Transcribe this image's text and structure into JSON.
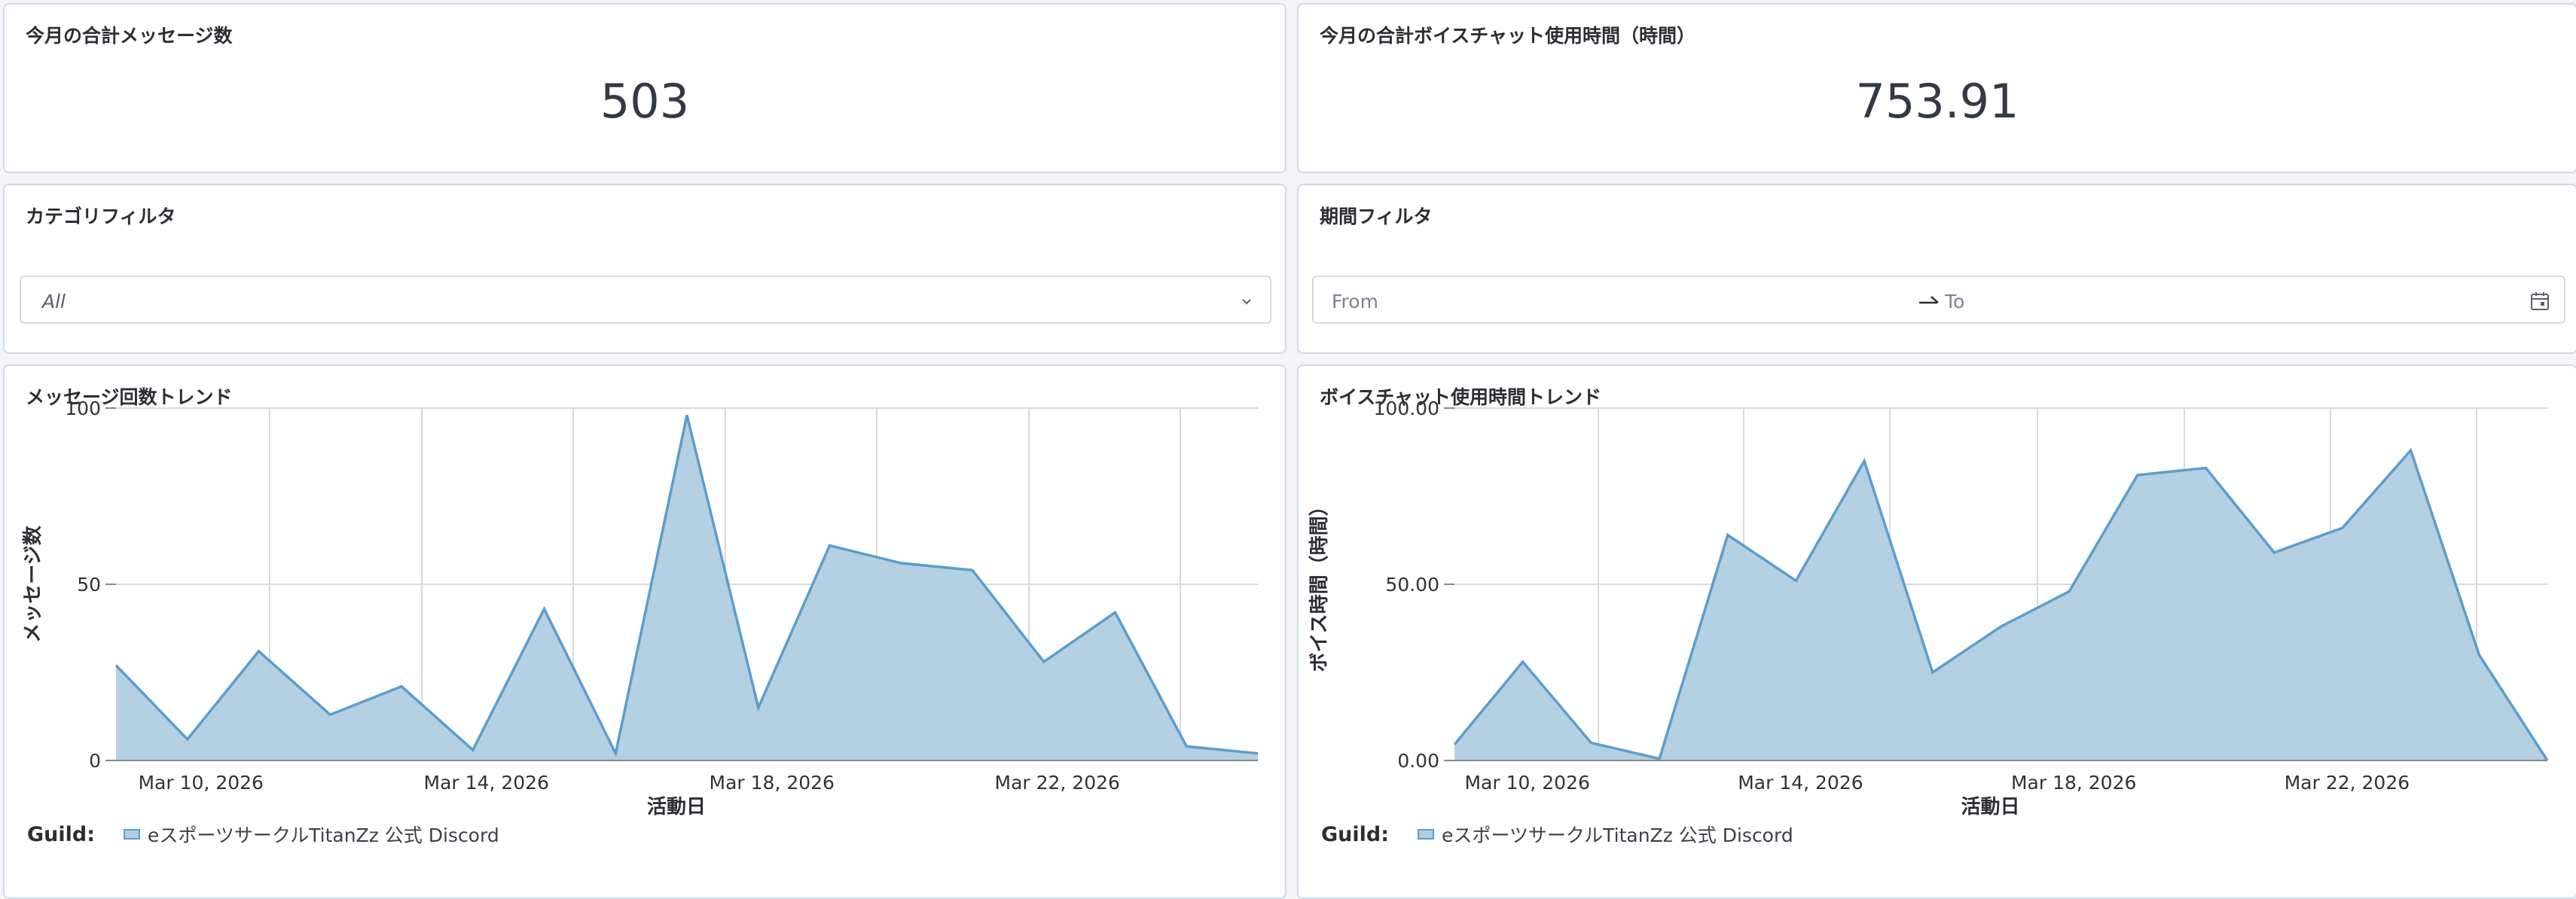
{
  "kpi_messages": {
    "title": "今月の合計メッセージ数",
    "value": "503"
  },
  "kpi_voice": {
    "title": "今月の合計ボイスチャット使用時間（時間）",
    "value": "753.91"
  },
  "category_filter": {
    "title": "カテゴリフィルタ",
    "selected": "All"
  },
  "period_filter": {
    "title": "期間フィルタ",
    "from_placeholder": "From",
    "to_placeholder": "To"
  },
  "message_trend": {
    "title": "メッセージ回数トレンド",
    "legend_label": "Guild:",
    "legend_item": "eスポーツサークルTitanZz 公式 Discord"
  },
  "voice_trend": {
    "title": "ボイスチャット使用時間トレンド",
    "legend_label": "Guild:",
    "legend_item": "eスポーツサークルTitanZz 公式 Discord"
  },
  "colors": {
    "area_fill": "#b0cde2",
    "area_line": "#5d9dcc",
    "card_border": "#cfdbe4",
    "background": "#f3f5f8"
  },
  "chart_data": [
    {
      "type": "area",
      "ylabel": "メッセージ数",
      "xlabel": "活動日",
      "x": [
        "2026-03-09",
        "2026-03-10",
        "2026-03-11",
        "2026-03-12",
        "2026-03-13",
        "2026-03-14",
        "2026-03-15",
        "2026-03-16",
        "2026-03-17",
        "2026-03-18",
        "2026-03-19",
        "2026-03-20",
        "2026-03-21",
        "2026-03-22",
        "2026-03-23",
        "2026-03-24",
        "2026-03-25"
      ],
      "series": [
        {
          "name": "eスポーツサークルTitanZz 公式 Discord",
          "values": [
            27,
            6,
            31,
            13,
            21,
            3,
            43,
            2,
            98,
            15,
            61,
            56,
            54,
            28,
            42,
            4,
            2
          ]
        }
      ],
      "ylim": [
        0,
        100
      ],
      "yticks": [
        "0",
        "50",
        "100"
      ],
      "xticks": [
        "Mar 10, 2026",
        "Mar 14, 2026",
        "Mar 18, 2026",
        "Mar 22, 2026"
      ],
      "grid": true,
      "legend": "bottom-left"
    },
    {
      "type": "area",
      "ylabel": "ボイス時間（時間）",
      "xlabel": "活動日",
      "x": [
        "2026-03-09",
        "2026-03-10",
        "2026-03-11",
        "2026-03-12",
        "2026-03-13",
        "2026-03-14",
        "2026-03-15",
        "2026-03-16",
        "2026-03-17",
        "2026-03-18",
        "2026-03-19",
        "2026-03-20",
        "2026-03-21",
        "2026-03-22",
        "2026-03-23",
        "2026-03-24",
        "2026-03-25"
      ],
      "series": [
        {
          "name": "eスポーツサークルTitanZz 公式 Discord",
          "values": [
            4.5,
            28,
            5,
            0.5,
            64,
            51,
            85,
            25,
            38,
            48,
            81,
            83,
            59,
            66,
            88,
            30,
            0
          ]
        }
      ],
      "ylim": [
        0,
        100
      ],
      "yticks": [
        "0.00",
        "50.00",
        "100.00"
      ],
      "xticks": [
        "Mar 10, 2026",
        "Mar 14, 2026",
        "Mar 18, 2026",
        "Mar 22, 2026"
      ],
      "grid": true,
      "legend": "bottom-left"
    }
  ]
}
